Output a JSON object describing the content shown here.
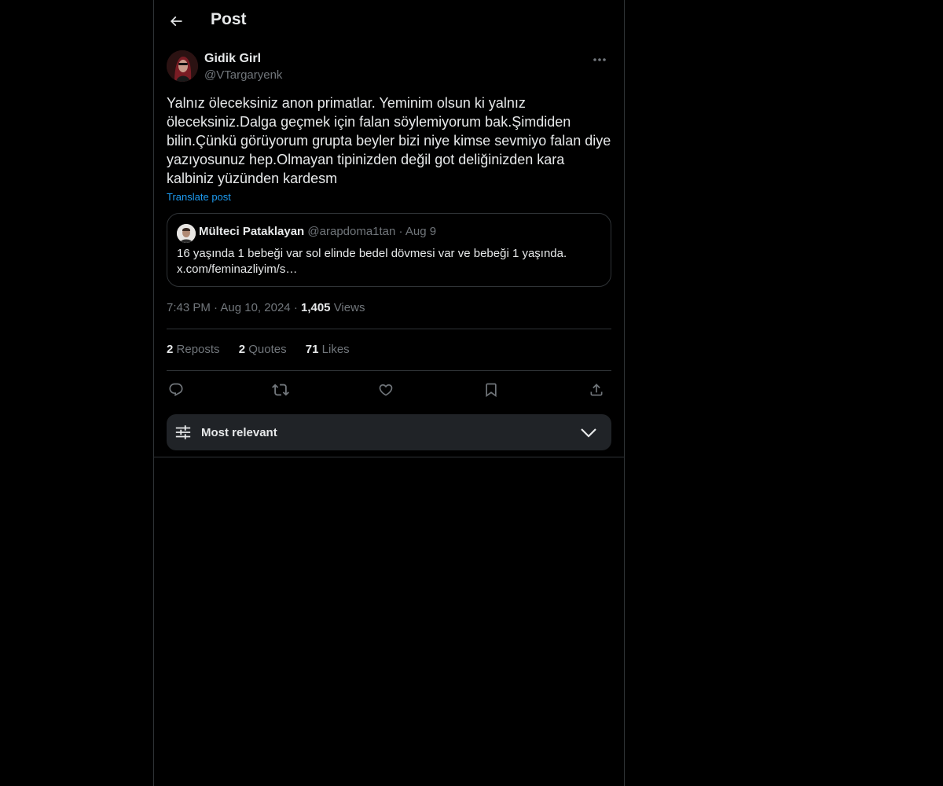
{
  "header": {
    "title": "Post",
    "back_icon": "arrow-left-icon"
  },
  "post": {
    "author_name": "Gidik Girl",
    "author_handle": "@VTargaryenk",
    "text": "Yalnız öleceksiniz anon primatlar. Yeminim olsun ki yalnız\nöleceksiniz.Dalga geçmek için falan söylemiyorum bak.Şimdiden\nbilin.Çünkü görüyorum grupta beyler bizi niye kimse sevmiyo falan diye\nyazıyosunuz hep.Olmayan tipinizden değil got deliğinizden kara\nkalbiniz yüzünden kardesm",
    "translate_label": "Translate post",
    "time": "7:43 PM",
    "date": "Aug 10, 2024",
    "views_count": "1,405",
    "views_label": "Views"
  },
  "quote": {
    "author_name": "Mülteci Pataklayan",
    "author_handle": "@arapdoma1tan",
    "date": "Aug 9",
    "text": "16 yaşında 1 bebeği var sol elinde bedel dövmesi var ve bebeği 1 yaşında.\nx.com/feminazliyim/s…"
  },
  "stats": {
    "reposts_count": "2",
    "reposts_label": "Reposts",
    "quotes_count": "2",
    "quotes_label": "Quotes",
    "likes_count": "71",
    "likes_label": "Likes"
  },
  "actions": [
    "reply-icon",
    "repost-icon",
    "like-icon",
    "bookmark-icon",
    "share-icon"
  ],
  "sort": {
    "label": "Most relevant"
  },
  "colors": {
    "background": "#000000",
    "text": "#e7e9ea",
    "secondary": "#71767b",
    "accent": "#1d9bf0",
    "border": "#2f3336",
    "sort_bg": "#202327"
  }
}
